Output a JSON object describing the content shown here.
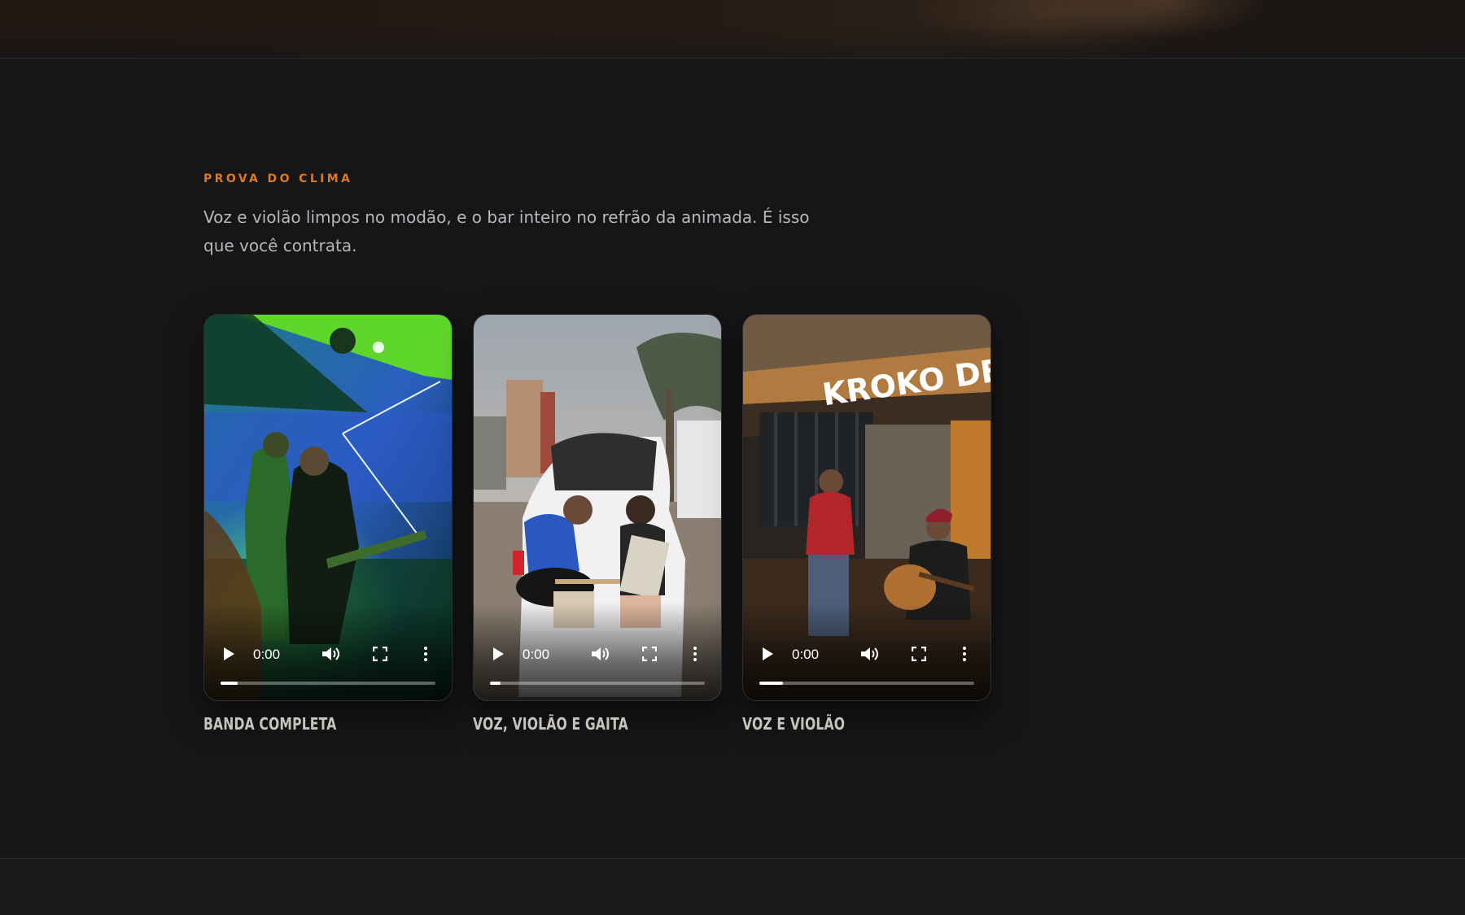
{
  "section": {
    "eyebrow": "PROVA DO CLIMA",
    "lead": "Voz e violão limpos no modão, e o bar inteiro no refrão da animada. É isso que você contrata."
  },
  "videos": [
    {
      "caption": "BANDA COMPLETA",
      "time": "0:00",
      "progress_fraction": 0.08,
      "scene": "band-stage-green-lights"
    },
    {
      "caption": "VOZ, VIOLÃO E GAITA",
      "time": "0:00",
      "progress_fraction": 0.05,
      "scene": "duo-car-trunk-guitar-accordion"
    },
    {
      "caption": "VOZ E VIOLÃO",
      "time": "0:00",
      "progress_fraction": 0.11,
      "scene": "duo-bar-guitar",
      "sign_text": "KROKO DE"
    }
  ],
  "colors": {
    "background": "#161618",
    "accent": "#e0781e",
    "lead_text": "#b7b7bb",
    "caption_text": "#c7c3bd"
  },
  "icons": [
    "play-icon",
    "volume-icon",
    "fullscreen-icon",
    "more-options-icon"
  ]
}
